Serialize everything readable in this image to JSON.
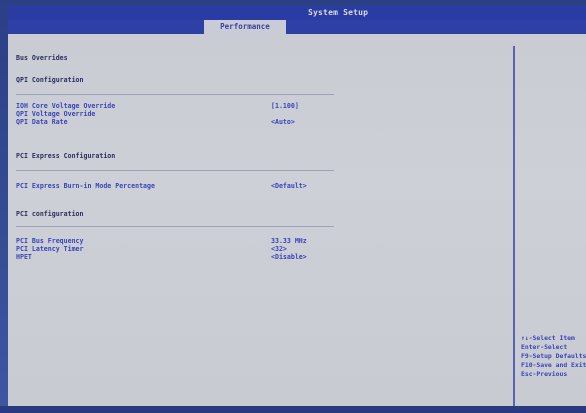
{
  "header": {
    "system_title": "System Setup",
    "active_tab": "Performance"
  },
  "settings": [
    {
      "label": "Bus Overrides",
      "kind": "header"
    },
    {
      "label": "QPI Configuration",
      "kind": "header"
    },
    {
      "label": "IOH Core Voltage Override",
      "kind": "option",
      "value": "[1.100]"
    },
    {
      "label": "QPI Voltage Override",
      "kind": "option",
      "value": ""
    },
    {
      "label": "QPI Data Rate",
      "kind": "option",
      "value": "<Auto>"
    },
    {
      "label": "PCI Express Configuration",
      "kind": "header"
    },
    {
      "label": "PCI Express Burn-in Mode Percentage",
      "kind": "option",
      "value": "<Default>"
    },
    {
      "label": "PCI configuration",
      "kind": "header"
    },
    {
      "label": "PCI Bus Frequency",
      "kind": "option",
      "value": "33.33 MHz"
    },
    {
      "label": "PCI Latency Timer",
      "kind": "option",
      "value": "<32>"
    },
    {
      "label": "HPET",
      "kind": "option",
      "value": "<Disable>"
    }
  ],
  "help_keys": [
    "↑↓-Select Item",
    "Enter-Select",
    "F9-Setup Defaults",
    "F10-Save and Exit",
    "Esc-Previous"
  ]
}
